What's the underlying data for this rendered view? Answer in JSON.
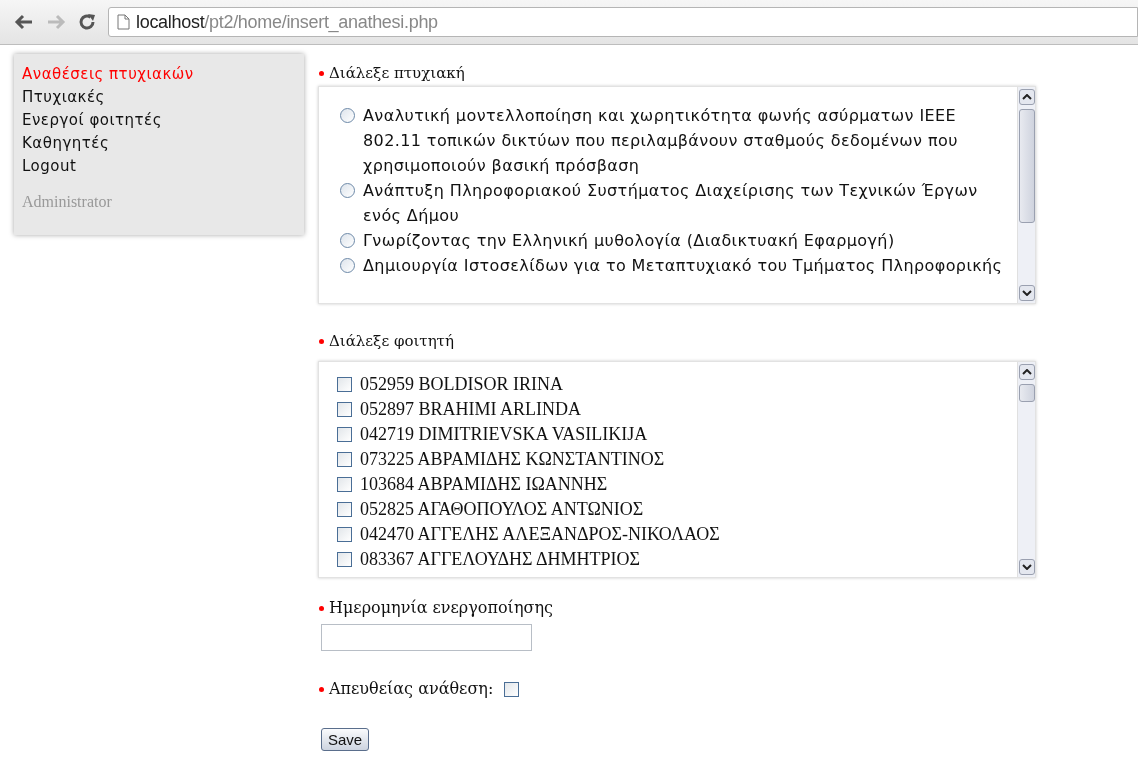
{
  "browser": {
    "url_host": "localhost",
    "url_path": "/pt2/home/insert_anathesi.php"
  },
  "sidebar": {
    "items": [
      {
        "label": "Αναθέσεις πτυχιακών",
        "selected": true
      },
      {
        "label": "Πτυχιακές",
        "selected": false
      },
      {
        "label": "Ενεργοί φοιτητές",
        "selected": false
      },
      {
        "label": "Καθηγητές",
        "selected": false
      },
      {
        "label": "Logout",
        "selected": false
      }
    ],
    "role": "Administrator"
  },
  "form": {
    "thesis_field": {
      "label": "Διάλεξε πτυχιακή",
      "options": [
        {
          "text": "Αναλυτική μοντελλοποίηση και χωρητικότητα φωνής ασύρματων ΙΕΕΕ 802.11 τοπικών δικτύων που περιλαμβάνουν σταθμούς δεδομένων που χρησιμοποιούν βασική πρόσβαση",
          "selected": false
        },
        {
          "text": "Ανάπτυξη Πληροφοριακού Συστήματος Διαχείρισης των Τεχνικών Έργων ενός Δήμου",
          "selected": false
        },
        {
          "text": "Γνωρίζοντας την Ελληνική μυθολογία (Διαδικτυακή Εφαρμογή)",
          "selected": false
        },
        {
          "text": "Δημιουργία Ιστοσελίδων για το Μεταπτυχιακό του Τμήματος Πληροφορικής",
          "selected": false
        }
      ]
    },
    "student_field": {
      "label": "Διάλεξε φοιτητή",
      "options": [
        {
          "text": "052959 BOLDISOR IRINA",
          "checked": false
        },
        {
          "text": "052897 BRAHIMI ARLINDA",
          "checked": false
        },
        {
          "text": "042719 DIMITRIEVSKA VASILIKIJA",
          "checked": false
        },
        {
          "text": "073225 ΑΒΡΑΜΙΔΗΣ ΚΩΝΣΤΑΝΤΙΝΟΣ",
          "checked": false
        },
        {
          "text": "103684 ΑΒΡΑΜΙΔΗΣ ΙΩΑΝΝΗΣ",
          "checked": false
        },
        {
          "text": "052825 ΑΓΑΘΟΠΟΥΛΟΣ ΑΝΤΩΝΙΟΣ",
          "checked": false
        },
        {
          "text": "042470 ΑΓΓΕΛΗΣ ΑΛΕΞΑΝΔΡΟΣ-ΝΙΚΟΛΑΟΣ",
          "checked": false
        },
        {
          "text": "083367 ΑΓΓΕΛΟΥΔΗΣ ΔΗΜΗΤΡΙΟΣ",
          "checked": false
        }
      ]
    },
    "date_field": {
      "label": "Ημερομηνία ενεργοποίησης"
    },
    "direct_field": {
      "label": "Απευθείας ανάθεση:",
      "checked": false
    },
    "save_button": {
      "label": "Save"
    }
  }
}
